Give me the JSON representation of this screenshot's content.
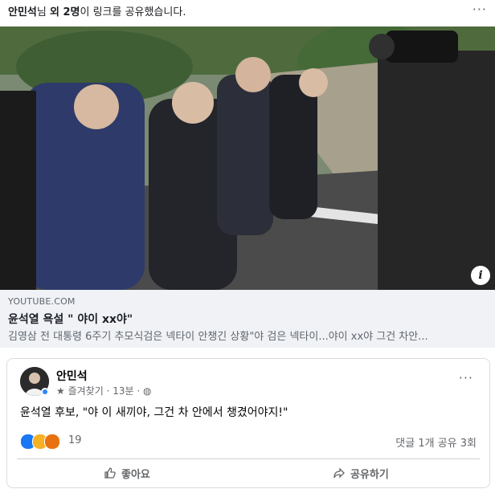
{
  "header": {
    "name": "안민석",
    "suffix_1": "님 ",
    "others": "외 2명",
    "suffix_2": "이 링크를 공유했습니다.",
    "more": "···"
  },
  "link": {
    "source": "YOUTUBE.COM",
    "title": "윤석열 욕설 \" 야이 xx야\"",
    "description": "김영삼 전 대통령 6주기 추모식검은 넥타이 안챙긴 상황\"야 검은 넥타이...야이 xx야 그건 차안..."
  },
  "post": {
    "author": "안민석",
    "meta_badge": "즐겨찾기",
    "meta_time": "13분",
    "meta_sep": "·",
    "more": "···",
    "text": "윤석열 후보, \"야 이 새끼야, 그건 차 안에서 챙겼어야지!\"",
    "reaction_count": "19",
    "comments": "댓글 1개",
    "shares": "공유 3회",
    "like_label": "좋아요",
    "share_label": "공유하기"
  },
  "colors": {
    "link_bg": "#f0f2f5",
    "like_blue": "#1877f2",
    "text_gray": "#65676b"
  }
}
